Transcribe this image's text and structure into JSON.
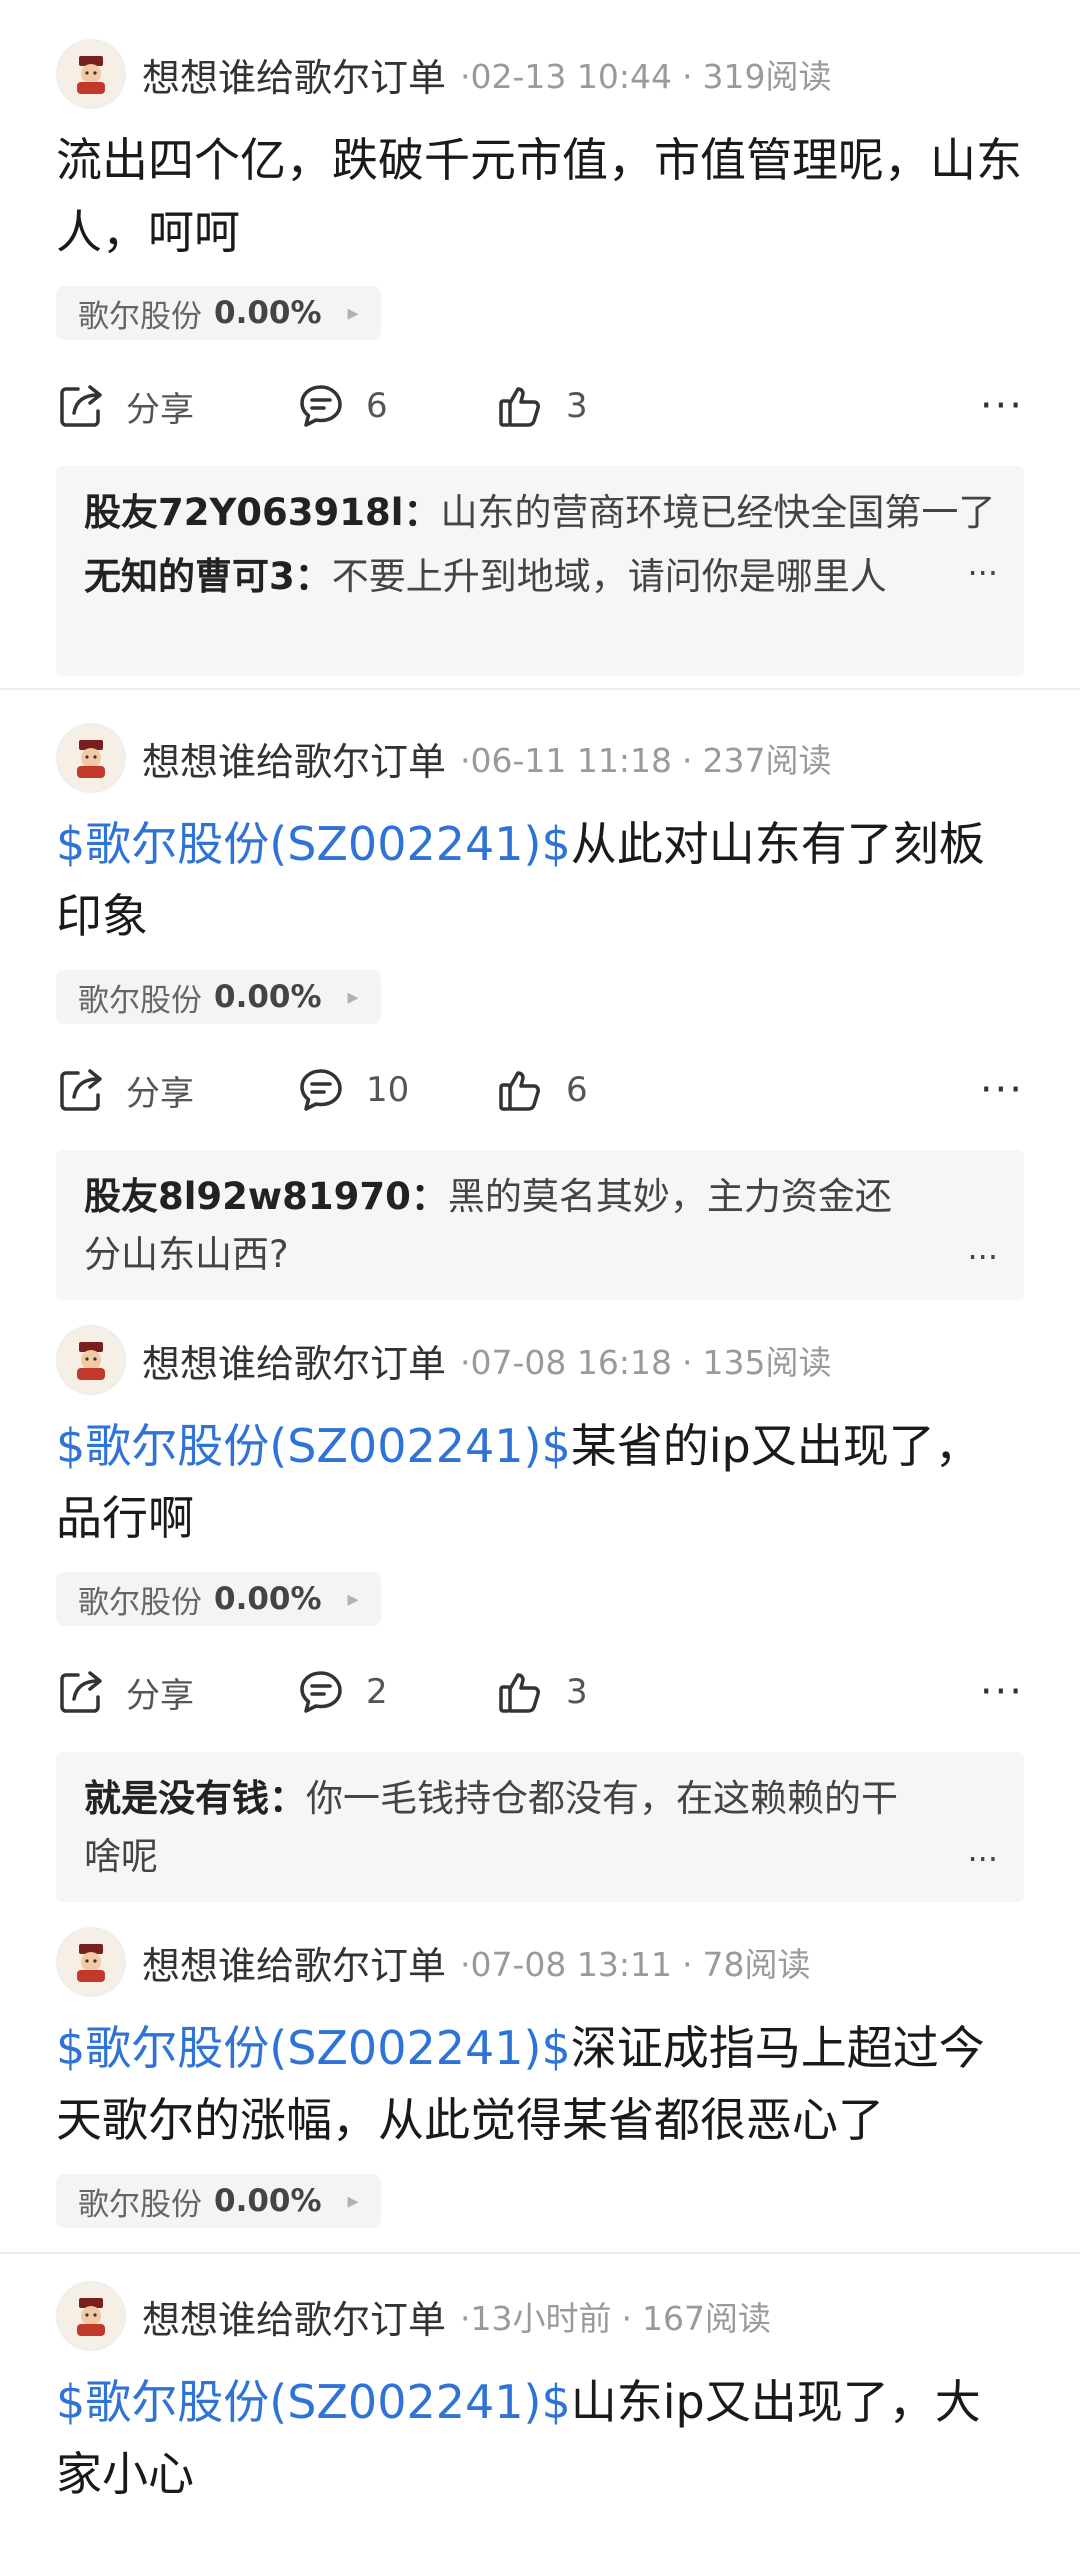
{
  "posts": [
    {
      "author": "想想谁给歌尔订单",
      "time": "02-13 10:44",
      "reads": "319阅读",
      "tag": "",
      "text": "流出四个亿，跌破千元市值，市值管理呢，山东人，呵呵",
      "stock_name": "歌尔股份",
      "stock_pct": "0.00%",
      "share_label": "分享",
      "comment_count": "6",
      "like_count": "3",
      "comments": [
        {
          "user": "股友72Y063918l",
          "sep": "：",
          "text": "山东的营商环境已经快全国第一了"
        },
        {
          "user": "无知的曹可3",
          "sep": "：",
          "text": "不要上升到地域，请问你是哪里人"
        }
      ]
    },
    {
      "author": "想想谁给歌尔订单",
      "time": "06-11 11:18",
      "reads": "237阅读",
      "tag": "$歌尔股份(SZ002241)$",
      "text": "从此对山东有了刻板印象",
      "stock_name": "歌尔股份",
      "stock_pct": "0.00%",
      "share_label": "分享",
      "comment_count": "10",
      "like_count": "6",
      "comments": [
        {
          "user": "股友8l92w81970",
          "sep": "：",
          "text": "黑的莫名其妙，主力资金还分山东山西?"
        }
      ]
    },
    {
      "author": "想想谁给歌尔订单",
      "time": "07-08 16:18",
      "reads": "135阅读",
      "tag": "$歌尔股份(SZ002241)$",
      "text": "某省的ip又出现了，品行啊",
      "stock_name": "歌尔股份",
      "stock_pct": "0.00%",
      "share_label": "分享",
      "comment_count": "2",
      "like_count": "3",
      "comments": [
        {
          "user": "就是没有钱",
          "sep": "：",
          "text": "你一毛钱持仓都没有，在这赖赖的干啥呢"
        }
      ]
    },
    {
      "author": "想想谁给歌尔订单",
      "time": "07-08 13:11",
      "reads": "78阅读",
      "tag": "$歌尔股份(SZ002241)$",
      "text": "深证成指马上超过今天歌尔的涨幅，从此觉得某省都很恶心了",
      "stock_name": "歌尔股份",
      "stock_pct": "0.00%"
    },
    {
      "author": "想想谁给歌尔订单",
      "time": "13小时前",
      "reads": "167阅读",
      "tag": "$歌尔股份(SZ002241)$",
      "text": "山东ip又出现了，大家小心"
    }
  ],
  "more_glyph": "···",
  "chip_arrow": "▸",
  "dot": "·",
  "icons": {
    "share": "share-icon",
    "comment": "comment-icon",
    "like": "thumbs-up-icon",
    "avatar": "god-of-wealth-avatar"
  }
}
